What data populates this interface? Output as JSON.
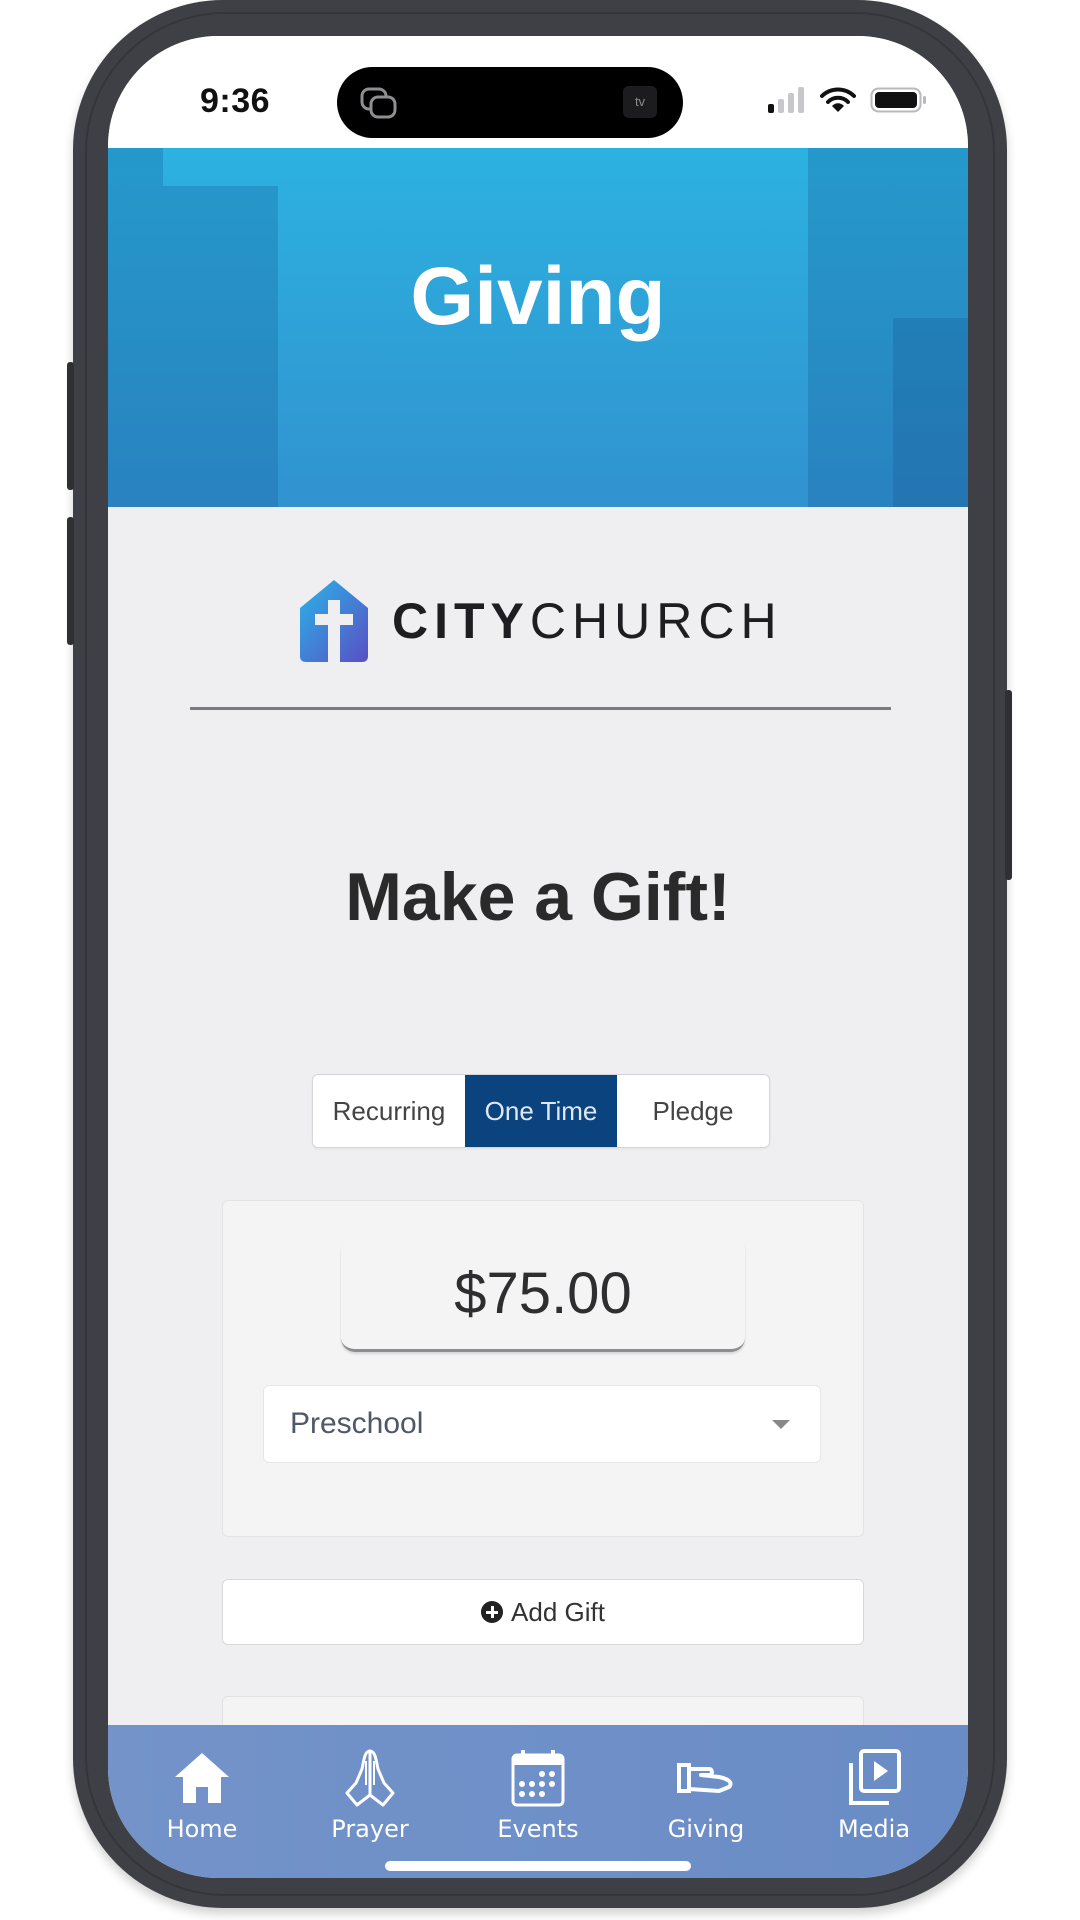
{
  "status_bar": {
    "time": "9:36",
    "island_app_label": "tv",
    "signal_bars_active": 1,
    "signal_bars_total": 4,
    "battery_level": "full"
  },
  "header": {
    "title": "Giving",
    "colors": {
      "top": "#2cb2e0",
      "bottom": "#3192cf"
    }
  },
  "logo": {
    "bold_part": "CITY",
    "light_part": "CHURCH",
    "icon": "church-house-cross-icon"
  },
  "main": {
    "heading": "Make a Gift!",
    "frequency_tabs": [
      {
        "label": "Recurring",
        "active": false
      },
      {
        "label": "One Time",
        "active": true
      },
      {
        "label": "Pledge",
        "active": false
      }
    ],
    "active_tab_color": "#0b437e",
    "gift": {
      "amount": "$75.00",
      "fund": "Preschool"
    },
    "add_gift_label": "Add Gift"
  },
  "tab_bar": {
    "items": [
      {
        "label": "Home",
        "icon": "home-icon"
      },
      {
        "label": "Prayer",
        "icon": "praying-hands-icon"
      },
      {
        "label": "Events",
        "icon": "calendar-icon"
      },
      {
        "label": "Giving",
        "icon": "giving-hand-icon"
      },
      {
        "label": "Media",
        "icon": "media-play-icon"
      }
    ],
    "background": "#7393c9"
  }
}
